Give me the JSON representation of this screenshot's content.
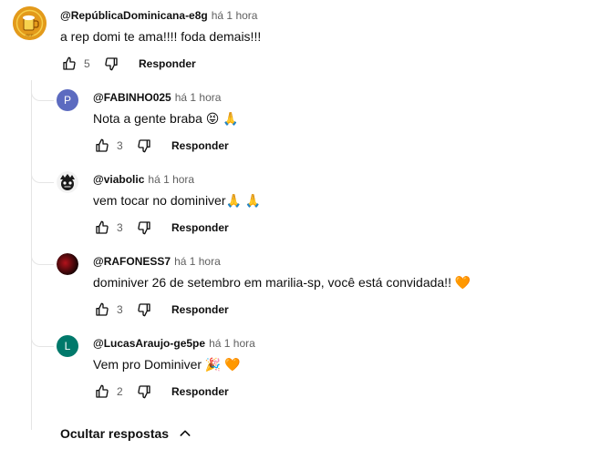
{
  "colors": {
    "text": "#0f0f0f",
    "secondary": "#606060",
    "line": "#e5e5e5"
  },
  "main_comment": {
    "avatar_icon": "beer-mug-logo-icon",
    "author": "@RepúblicaDominicana-e8g",
    "time": "há 1 hora",
    "text": "a rep domi te ama!!!! foda demais!!!",
    "likes": "5",
    "reply_label": "Responder"
  },
  "replies": [
    {
      "avatar_letter": "P",
      "avatar_color": "#5c6bc0",
      "author": "@FABINHO025",
      "time": "há 1 hora",
      "text": "Nota a gente braba 😝 🙏",
      "likes": "3",
      "reply_label": "Responder"
    },
    {
      "avatar_icon": "masked-face-avatar-icon",
      "author": "@viabolic",
      "time": "há 1 hora",
      "text": "vem tocar no dominiver🙏 🙏",
      "likes": "3",
      "reply_label": "Responder"
    },
    {
      "avatar_icon": "dark-red-photo-avatar-icon",
      "author": "@RAFONESS7",
      "time": "há 1 hora",
      "text": "dominiver 26 de setembro em marilia-sp, você está convidada!! 🧡",
      "likes": "3",
      "reply_label": "Responder"
    },
    {
      "avatar_letter": "L",
      "avatar_color": "#00796b",
      "author": "@LucasAraujo-ge5pe",
      "time": "há 1 hora",
      "text": "Vem pro Dominiver 🎉 🧡",
      "likes": "2",
      "reply_label": "Responder"
    }
  ],
  "hide_replies_label": "Ocultar respostas"
}
